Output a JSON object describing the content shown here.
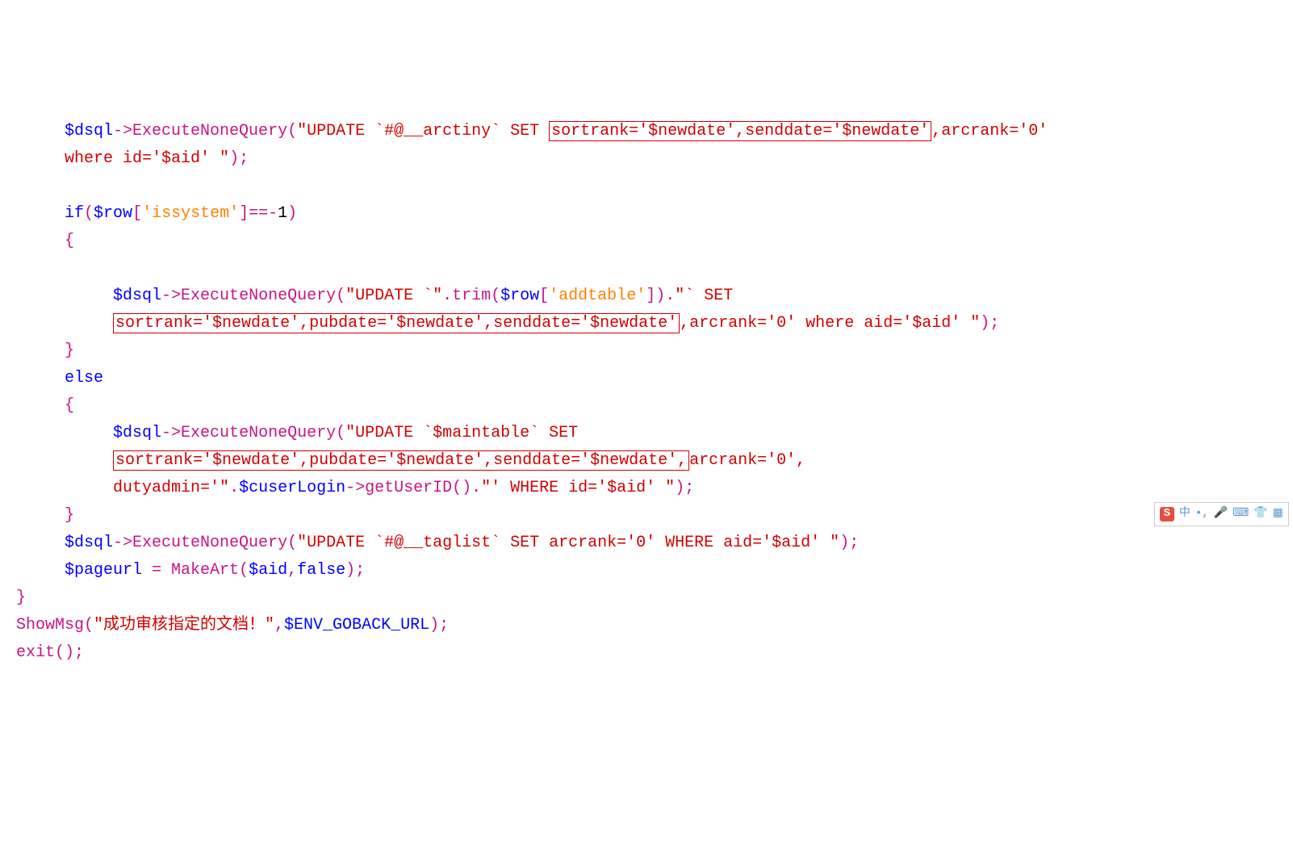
{
  "code": {
    "indent1": "     ",
    "indent2": "          ",
    "l1": {
      "a": "$dsql",
      "b": "->ExecuteNoneQuery(",
      "c": "\"UPDATE `#@__arctiny` SET ",
      "d": "sortrank='$newdate',senddate='$newdate'",
      "e": ",arcrank='0' "
    },
    "l2": {
      "a": "where id='$aid' \"",
      "b": ");"
    },
    "l3": {
      "a": "if",
      "b": "(",
      "c": "$row",
      "d": "[",
      "e": "'issystem'",
      "f": "]==-",
      "g": "1",
      "h": ")"
    },
    "l4": "{",
    "l5": {
      "a": "$dsql",
      "b": "->ExecuteNoneQuery(",
      "c": "\"UPDATE `\"",
      "d": ".trim(",
      "e": "$row",
      "f": "[",
      "g": "'addtable'",
      "h": "]).",
      "i": "\"` SET "
    },
    "l6": {
      "a": "sortrank='$newdate',pubdate='$newdate',senddate='$newdate'",
      "b": ",arcrank='0' where aid='$aid' \"",
      "c": ");"
    },
    "l7": "}",
    "l8": "else",
    "l9": "{",
    "l10": {
      "a": "$dsql",
      "b": "->ExecuteNoneQuery(",
      "c": "\"UPDATE `$maintable` SET "
    },
    "l11": {
      "a": "sortrank='$newdate',pubdate='$newdate',senddate='$newdate',",
      "b": "arcrank='0', "
    },
    "l12": {
      "a": "dutyadmin='\"",
      "b": ".",
      "c": "$cuserLogin",
      "d": "->getUserID().",
      "e": "\"' WHERE id='$aid' \"",
      "f": ");"
    },
    "l13": "}",
    "l14": {
      "a": "$dsql",
      "b": "->ExecuteNoneQuery(",
      "c": "\"UPDATE `#@__taglist` SET arcrank='0' WHERE aid='$aid' \"",
      "d": ");"
    },
    "l15": {
      "a": "$pageurl",
      "b": " = MakeArt(",
      "c": "$aid",
      "d": ",",
      "e": "false",
      "f": ");"
    },
    "l16": "}",
    "l17": {
      "a": "ShowMsg(",
      "b": "\"成功审核指定的文档！\"",
      "c": ",",
      "d": "$ENV_GOBACK_URL",
      "e": ");"
    },
    "l18": "exit();"
  },
  "statusbar": {
    "logo": "S",
    "lang": "中"
  }
}
